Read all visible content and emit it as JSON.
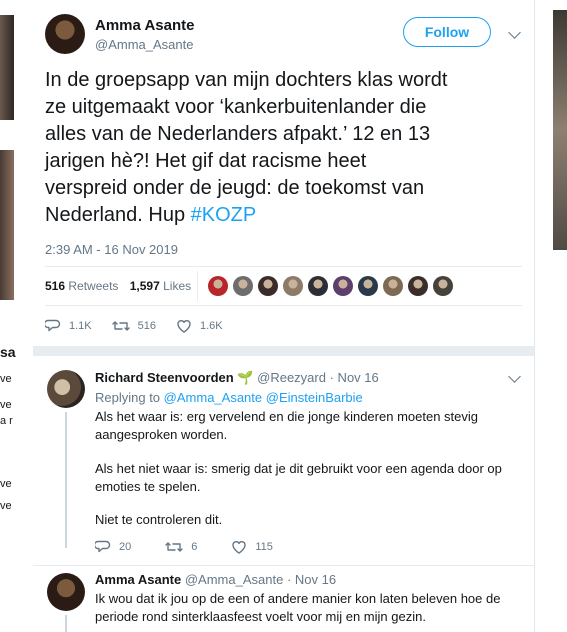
{
  "background": {
    "left_fragments": [
      "sa",
      "ve",
      "ve",
      "a r",
      "ve",
      "ve"
    ]
  },
  "main_tweet": {
    "author_name": "Amma Asante",
    "author_handle": "@Amma_Asante",
    "follow_label": "Follow",
    "text_lines": [
      "In de groepsapp van mijn dochters klas wordt",
      "ze uitgemaakt voor ‘kankerbuitenlander die",
      "alles van de Nederlanders afpakt.’ 12 en 13",
      "jarigen hè?! Het gif dat racisme heet",
      "verspreid onder de jeugd: de toekomst van"
    ],
    "last_line_prefix": "Nederland. Hup ",
    "hashtag": "#KOZP",
    "timestamp": "2:39 AM - 16 Nov 2019",
    "retweets_count": "516",
    "retweets_label": "Retweets",
    "likes_count": "1,597",
    "likes_label": "Likes",
    "liker_colors": [
      "#b8262b",
      "#6d6d6d",
      "#3a2c28",
      "#8d7a68",
      "#2d2d35",
      "#5d3f6e",
      "#2b3a4a",
      "#7d6a55",
      "#3b2e2a",
      "#47413c"
    ],
    "replies": "1.1K",
    "retweets": "516",
    "likes": "1.6K"
  },
  "reply1": {
    "author_name": "Richard Steenvoorden",
    "emoji": "🌱",
    "handle": "@Reezyard",
    "date": "· Nov 16",
    "replying_label": "Replying to",
    "replying_to": "@Amma_Asante @EinsteinBarbie",
    "paragraphs": [
      [
        "Als het waar is: erg vervelend en die jonge kinderen moeten stevig",
        "aangesproken worden."
      ],
      [
        "Als het niet waar is: smerig dat je dit gebruikt voor een agenda door op",
        "emoties te spelen."
      ],
      [
        "Niet te controleren dit."
      ]
    ],
    "replies": "20",
    "retweets": "6",
    "likes": "115"
  },
  "reply2": {
    "author_name": "Amma Asante",
    "handle": "@Amma_Asante",
    "date": "· Nov 16",
    "lines": [
      "Ik wou dat ik jou op de een of andere manier kon laten beleven hoe de",
      "periode rond sinterklaasfeest voelt voor mij en mijn gezin."
    ]
  }
}
